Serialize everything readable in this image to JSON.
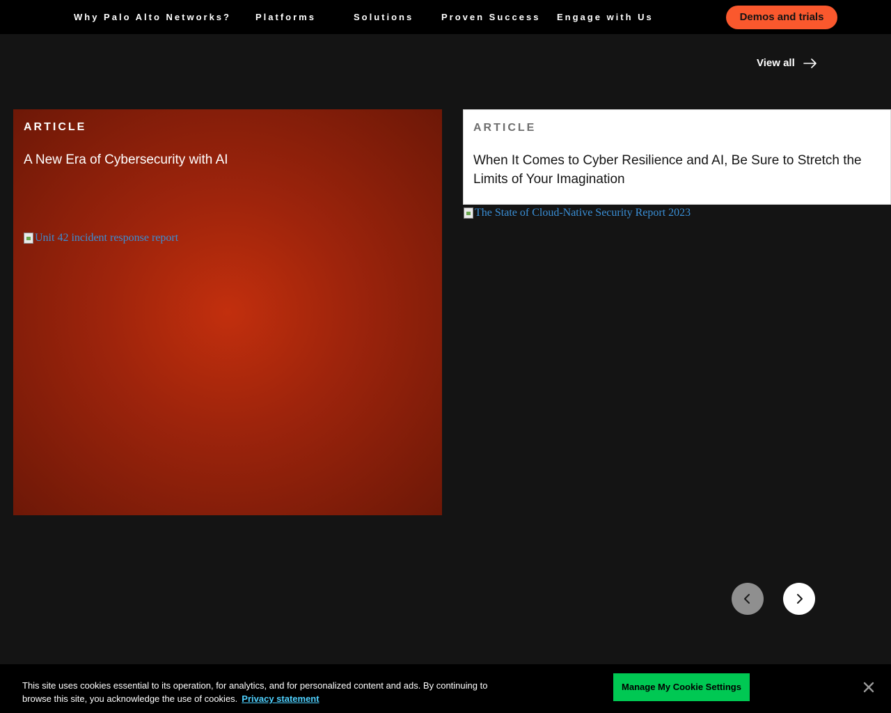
{
  "nav": {
    "items": [
      {
        "label": "Why Palo Alto Networks?"
      },
      {
        "label": "Platforms"
      },
      {
        "label": "Solutions"
      },
      {
        "label": "Proven Success"
      },
      {
        "label": "Engage with Us"
      }
    ],
    "cta_label": "Demos and trials"
  },
  "section": {
    "view_all_label": "View all"
  },
  "cards": [
    {
      "eyebrow": "ARTICLE",
      "title": "A New Era of Cybersecurity with AI",
      "image_alt": "Unit 42 incident response report"
    },
    {
      "eyebrow": "ARTICLE",
      "title": "When It Comes to Cyber Resilience and AI, Be Sure to Stretch the Limits of Your Imagination",
      "image_alt": "The State of Cloud-Native Security Report 2023"
    }
  ],
  "cookie": {
    "text": "This site uses cookies essential to its operation, for analytics, and for personalized content and ads. By continuing to browse this site, you acknowledge the use of cookies.",
    "privacy_label": "Privacy statement",
    "settings_label": "Manage My Cookie Settings"
  },
  "colors": {
    "accent": "#fa582d",
    "page_bg": "#141414",
    "cookie_button": "#00c853",
    "link": "#4fd1ff"
  },
  "icons": {
    "view_all": "arrow-right-icon",
    "prev": "chevron-left-icon",
    "next": "chevron-right-icon",
    "close": "close-icon",
    "broken_image": "broken-image-icon"
  }
}
